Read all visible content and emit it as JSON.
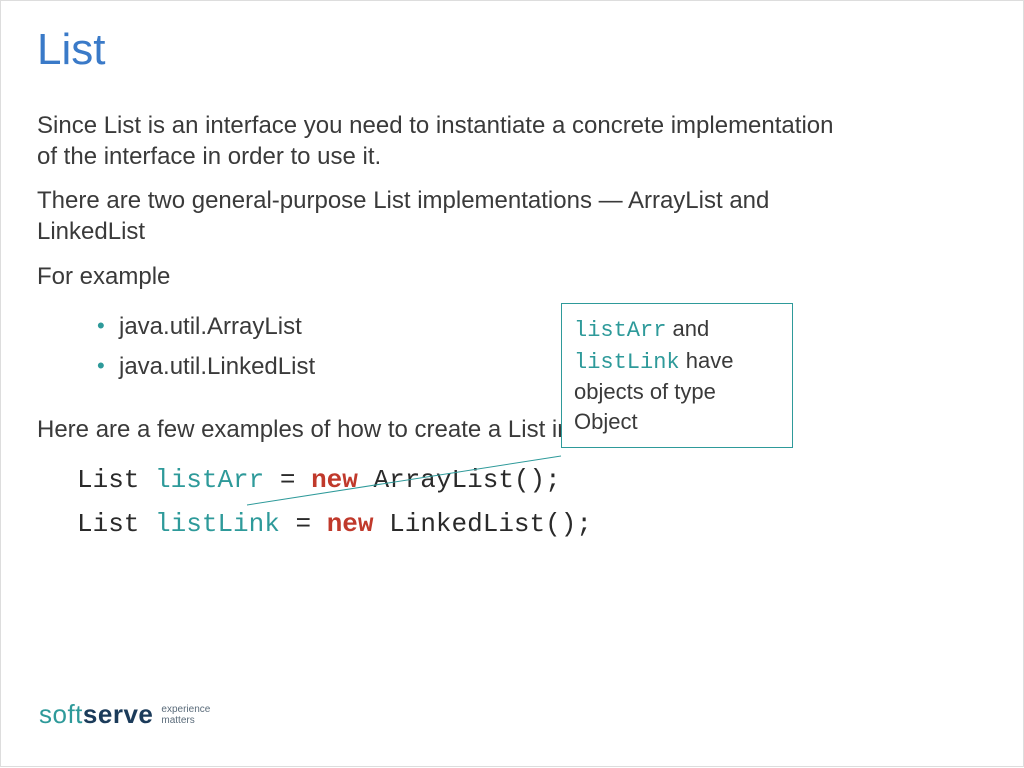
{
  "title": "List",
  "paragraphs": {
    "p1": "Since List is an interface you need to instantiate a concrete implementation of the interface in order to use it.",
    "p2": "There are two general-purpose List implementations — ArrayList and LinkedList",
    "p3": "For example",
    "p4": "Here are a few examples of how to create a List instance:"
  },
  "bullets": [
    "java.util.ArrayList",
    "java.util.LinkedList"
  ],
  "code": {
    "line1": {
      "type": "List",
      "var": "listArr",
      "op": "=",
      "kw": "new",
      "ctor": "ArrayList();"
    },
    "line2": {
      "type": "List",
      "var": "listLink",
      "op": "=",
      "kw": "new",
      "ctor": "LinkedList();"
    }
  },
  "callout": {
    "mono1": "listArr",
    "t1": " and ",
    "mono2": "listLink",
    "t2": " have objects of type Object"
  },
  "logo": {
    "soft": "soft",
    "serve": "serve",
    "tag1": "experience",
    "tag2": "matters"
  }
}
